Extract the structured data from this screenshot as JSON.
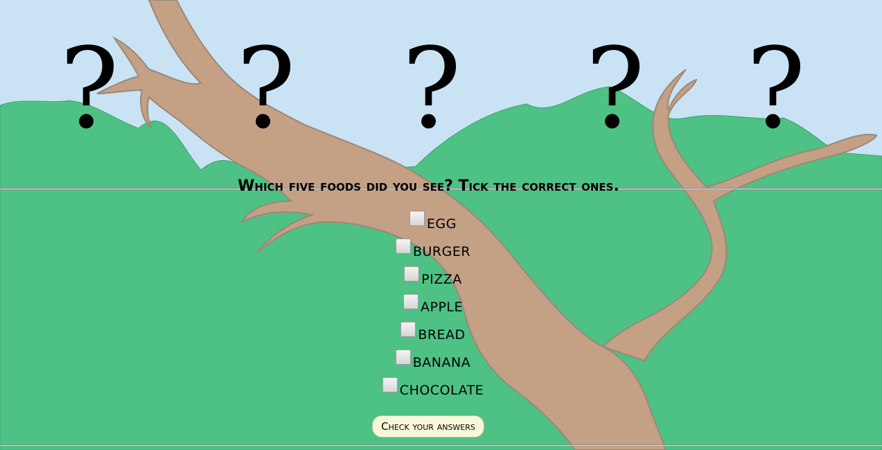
{
  "colors": {
    "sky": "#c9e3f5",
    "foliage": "#4ec184",
    "branch": "#c4a084",
    "branch_outline": "#9a8878",
    "button_bg": "#f8f8d8"
  },
  "header": {
    "question_marks": [
      "?",
      "?",
      "?",
      "?",
      "?"
    ]
  },
  "quiz": {
    "question": "Which five foods did you see? Tick the correct ones.",
    "options": [
      {
        "label": "EGG",
        "checked": false
      },
      {
        "label": "BURGER",
        "checked": false
      },
      {
        "label": "PIZZA",
        "checked": false
      },
      {
        "label": "APPLE",
        "checked": false
      },
      {
        "label": "BREAD",
        "checked": false
      },
      {
        "label": "BANANA",
        "checked": false
      },
      {
        "label": "CHOCOLATE",
        "checked": false
      }
    ],
    "submit_label": "Check your answers"
  }
}
